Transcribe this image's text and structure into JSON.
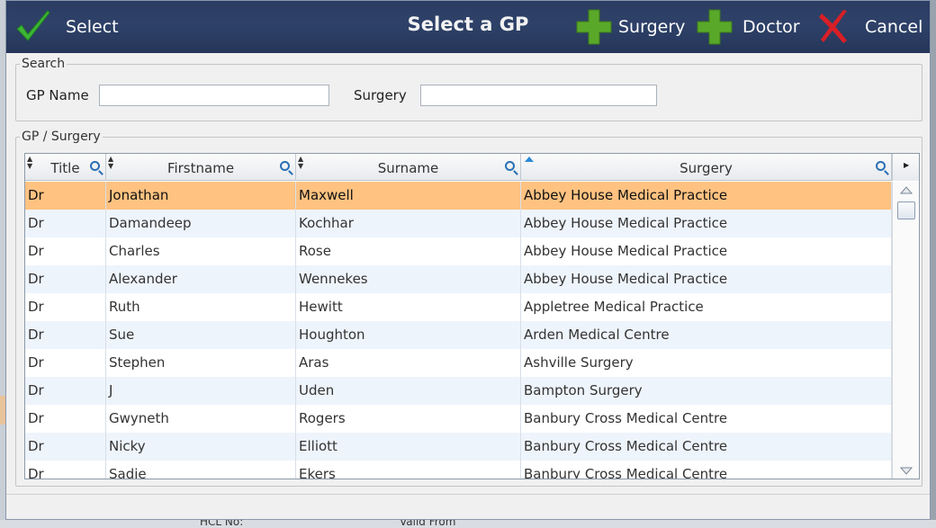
{
  "dialog": {
    "title": "Select a GP",
    "toolbar": {
      "select_label": "Select",
      "surgery_label": "Surgery",
      "doctor_label": "Doctor",
      "cancel_label": "Cancel"
    }
  },
  "search": {
    "legend": "Search",
    "gp_name_label": "GP Name",
    "gp_name_value": "",
    "surgery_label": "Surgery",
    "surgery_value": ""
  },
  "grid": {
    "legend": "GP / Surgery",
    "columns": [
      "Title",
      "Firstname",
      "Surname",
      "Surgery"
    ],
    "selected_row": 0,
    "rows": [
      [
        "Dr",
        "Jonathan",
        "Maxwell",
        "Abbey House Medical Practice"
      ],
      [
        "Dr",
        "Damandeep",
        "Kochhar",
        "Abbey House Medical Practice"
      ],
      [
        "Dr",
        "Charles",
        "Rose",
        "Abbey House Medical Practice"
      ],
      [
        "Dr",
        "Alexander",
        "Wennekes",
        "Abbey House Medical Practice"
      ],
      [
        "Dr",
        "Ruth",
        "Hewitt",
        "Appletree Medical Practice"
      ],
      [
        "Dr",
        "Sue",
        "Houghton",
        "Arden Medical Centre"
      ],
      [
        "Dr",
        "Stephen",
        "Aras",
        "Ashville Surgery"
      ],
      [
        "Dr",
        "J",
        "Uden",
        "Bampton Surgery"
      ],
      [
        "Dr",
        "Gwyneth",
        "Rogers",
        "Banbury Cross Medical Centre"
      ],
      [
        "Dr",
        "Nicky",
        "Elliott",
        "Banbury Cross Medical Centre"
      ],
      [
        "Dr",
        "Sadie",
        "Ekers",
        "Banbury Cross Medical Centre"
      ]
    ]
  },
  "background": {
    "fragments": [
      "HCL No:",
      "Valid From"
    ]
  },
  "colors": {
    "title_bar": "#2e4168",
    "selected_row": "#ffc281",
    "alt_row": "#eef4fb",
    "plus_green": "#5aa829",
    "check_green": "#3db535",
    "cancel_red": "#d81f26"
  }
}
